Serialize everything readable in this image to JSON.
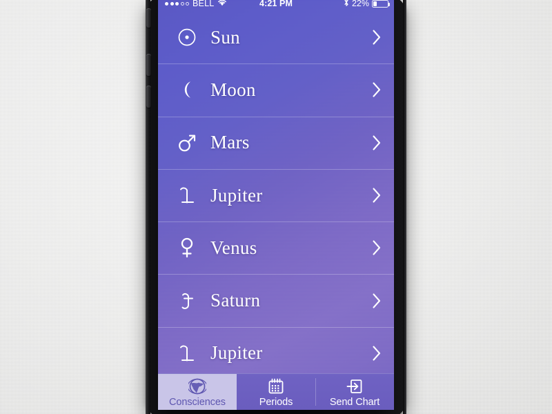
{
  "device": {
    "side_buttons": [
      "mute-switch",
      "volume-up",
      "volume-down"
    ]
  },
  "status_bar": {
    "signal_dots_filled": 3,
    "signal_dots_total": 5,
    "carrier": "BELL",
    "wifi_icon": "wifi-icon",
    "time": "4:21 PM",
    "bluetooth_icon": "bluetooth-icon",
    "battery_percent": "22%",
    "battery_level": 22,
    "battery_icon": "battery-icon"
  },
  "list": {
    "rows": [
      {
        "glyph": "☉",
        "icon_name": "sun-symbol-icon",
        "name": "Sun",
        "accessory": "chevron-right-icon"
      },
      {
        "glyph": "☾",
        "icon_name": "moon-symbol-icon",
        "name": "Moon",
        "accessory": "chevron-right-icon"
      },
      {
        "glyph": "♂",
        "icon_name": "mars-symbol-icon",
        "name": "Mars",
        "accessory": "chevron-right-icon"
      },
      {
        "glyph": "♃",
        "icon_name": "jupiter-symbol-icon",
        "name": "Jupiter",
        "accessory": "chevron-right-icon"
      },
      {
        "glyph": "♀",
        "icon_name": "venus-symbol-icon",
        "name": "Venus",
        "accessory": "chevron-right-icon"
      },
      {
        "glyph": "♄",
        "icon_name": "saturn-symbol-icon",
        "name": "Saturn",
        "accessory": "chevron-right-icon"
      },
      {
        "glyph": "♃",
        "icon_name": "jupiter-symbol-icon",
        "name": "Jupiter",
        "accessory": "chevron-right-icon"
      }
    ]
  },
  "tab_bar": {
    "tabs": [
      {
        "label": "Consciences",
        "icon_name": "globe-icon",
        "active": true
      },
      {
        "label": "Periods",
        "icon_name": "calendar-icon",
        "active": false
      },
      {
        "label": "Send Chart",
        "icon_name": "export-arrow-icon",
        "active": false
      }
    ]
  },
  "colors": {
    "screen_gradient_top": "#5a58c4",
    "screen_gradient_bottom": "#8470c8",
    "tab_bar_background": "#6a5dbe",
    "tab_active_background": "#c9c5e8",
    "tab_active_text": "#5e56b0",
    "text_on_screen": "#ffffff",
    "backdrop": "#f4f4f2"
  }
}
